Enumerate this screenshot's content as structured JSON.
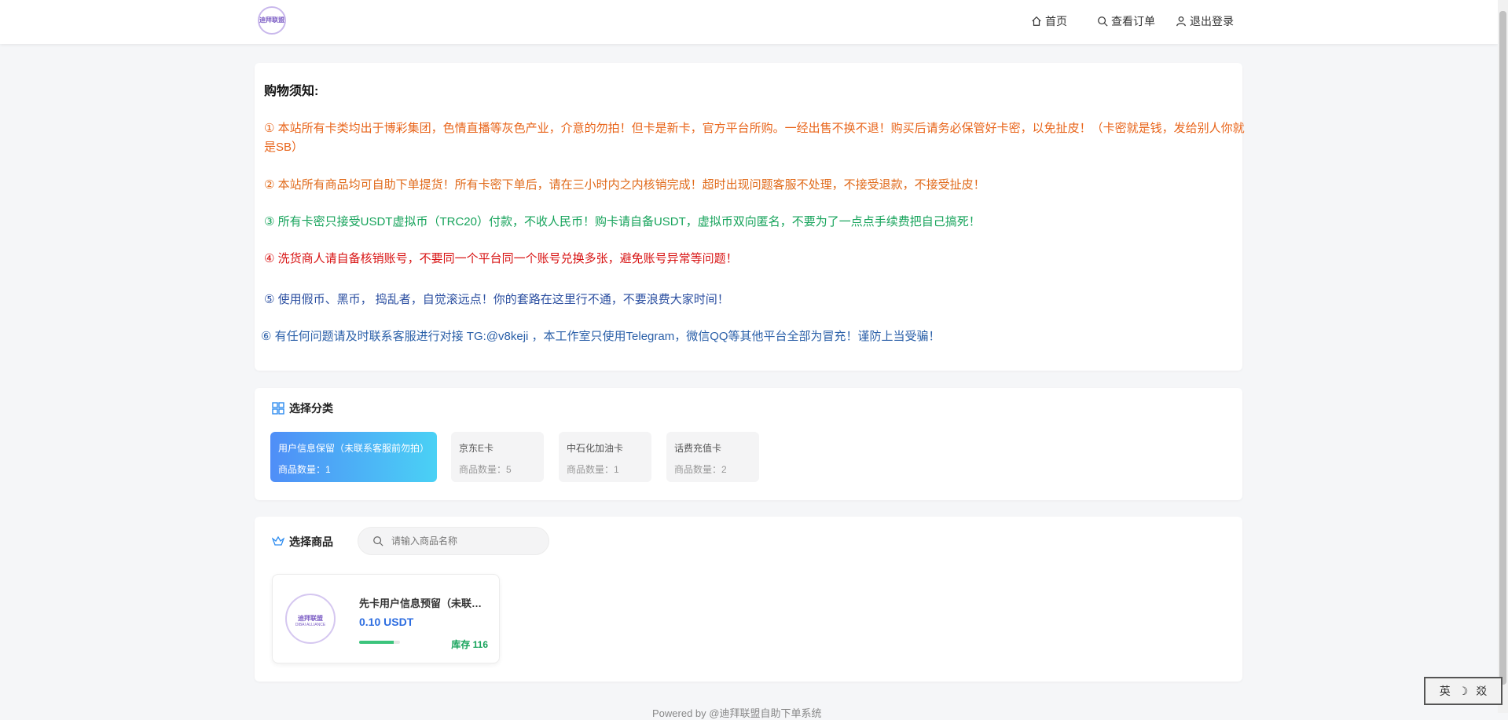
{
  "header": {
    "logo_text": "迪拜联盟",
    "nav": {
      "home": "首页",
      "orders": "查看订单",
      "logout": "退出登录"
    }
  },
  "notice": {
    "title": "购物须知:",
    "lines": [
      "① 本站所有卡类均出于博彩集团，色情直播等灰色产业，介意的勿拍！但卡是新卡，官方平台所购。一经出售不换不退！购买后请务必保管好卡密，以免扯皮！（卡密就是钱，发给别人你就是SB）",
      "② 本站所有商品均可自助下单提货！所有卡密下单后，请在三小时内之内核销完成！超时出现问题客服不处理，不接受退款，不接受扯皮！",
      "③ 所有卡密只接受USDT虚拟币（TRC20）付款，不收人民币！购卡请自备USDT，虚拟币双向匿名，不要为了一点点手续费把自己搞死！",
      "④ 洗货商人请自备核销账号，不要同一个平台同一个账号兑换多张，避免账号异常等问题！",
      "⑤ 使用假币、黑币， 捣乱者，自觉滚远点！你的套路在这里行不通，不要浪费大家时间！",
      "⑥ 有任何问题请及时联系客服进行对接 TG:@v8keji ，本工作室只使用Telegram，微信QQ等其他平台全部为冒充！谨防上当受骗！"
    ]
  },
  "category": {
    "title": "选择分类",
    "items": [
      {
        "name": "用户信息保留（未联系客服前勿拍）",
        "count": "商品数量：1",
        "active": true
      },
      {
        "name": "京东E卡",
        "count": "商品数量：5",
        "active": false
      },
      {
        "name": "中石化加油卡",
        "count": "商品数量：1",
        "active": false
      },
      {
        "name": "话费充值卡",
        "count": "商品数量：2",
        "active": false
      }
    ]
  },
  "goods": {
    "title": "选择商品",
    "search_placeholder": "请输入商品名称",
    "products": [
      {
        "name": "先卡用户信息预留（未联系客服前勿拍）",
        "price": "0.10 USDT",
        "stock": "库存 116",
        "image_text": "迪拜联盟",
        "image_subtext": "DIBAI ALLIANCE",
        "stock_level": 0.85
      }
    ]
  },
  "footer": {
    "text": "Powered by @迪拜联盟自助下单系统"
  },
  "ime": {
    "label": "英",
    "moon": "☽",
    "extra": "㸚"
  },
  "colors": {
    "accent_blue": "#2d6de0",
    "active_gradient_start": "#4f8ef7",
    "active_gradient_end": "#4ad1f5",
    "stock_green": "#16a35b"
  }
}
